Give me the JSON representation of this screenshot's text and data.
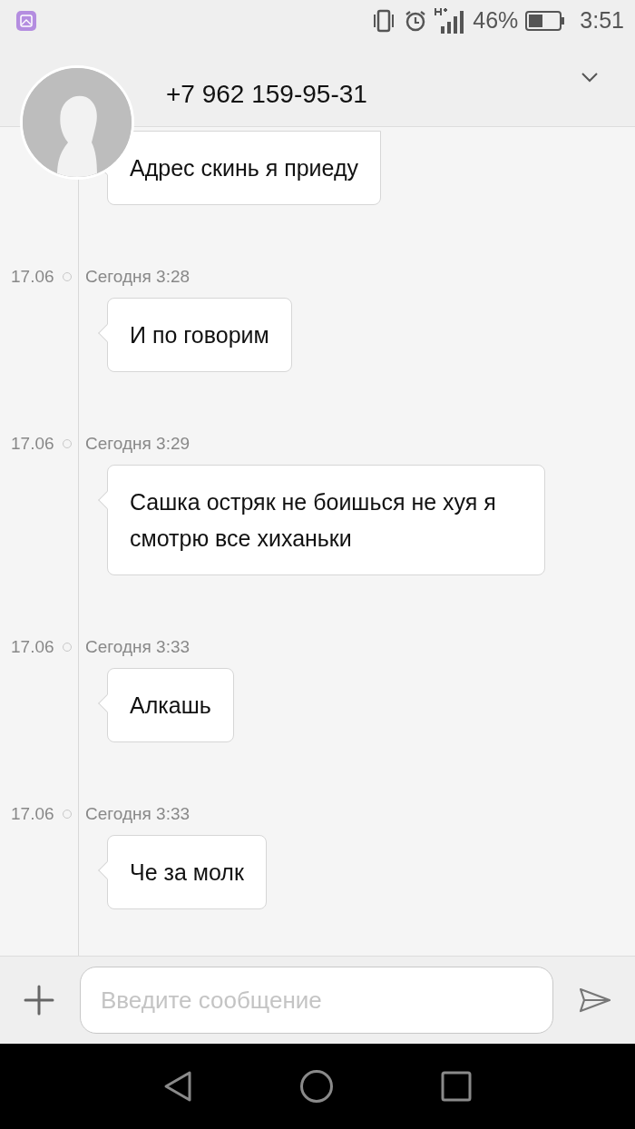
{
  "status_bar": {
    "battery": "46%",
    "time": "3:51"
  },
  "contact": {
    "phone": "+7 962 159-95-31"
  },
  "messages": [
    {
      "text": "Адрес скинь я приеду"
    },
    {
      "date": "17.06",
      "time": "Сегодня 3:28",
      "text": "И по говорим"
    },
    {
      "date": "17.06",
      "time": "Сегодня 3:29",
      "text": "Сашка остряк не боишься не хуя я смотрю все хиханьки"
    },
    {
      "date": "17.06",
      "time": "Сегодня 3:33",
      "text": "Алкашь"
    },
    {
      "date": "17.06",
      "time": "Сегодня 3:33",
      "text": "Че за молк"
    }
  ],
  "composer": {
    "placeholder": "Введите сообщение"
  }
}
